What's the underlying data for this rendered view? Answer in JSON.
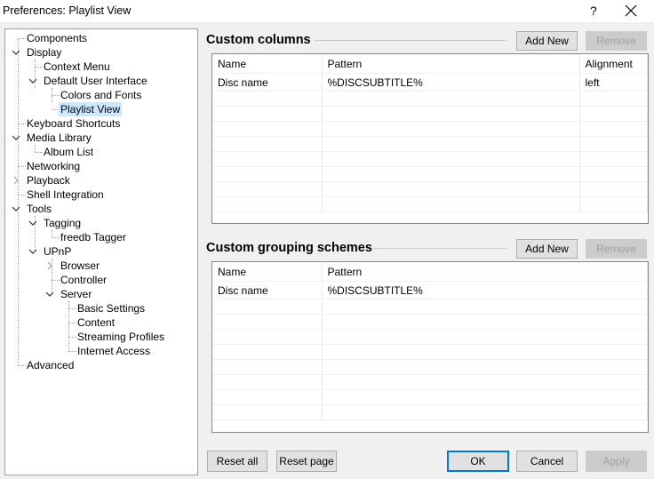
{
  "window": {
    "title": "Preferences: Playlist View",
    "help_label": "?"
  },
  "tree": {
    "components": "Components",
    "display": "Display",
    "context_menu": "Context Menu",
    "default_ui": "Default User Interface",
    "colors_fonts": "Colors and Fonts",
    "playlist_view": "Playlist View",
    "keyboard_shortcuts": "Keyboard Shortcuts",
    "media_library": "Media Library",
    "album_list": "Album List",
    "networking": "Networking",
    "playback": "Playback",
    "shell_integration": "Shell Integration",
    "tools": "Tools",
    "tagging": "Tagging",
    "freedb_tagger": "freedb Tagger",
    "upnp": "UPnP",
    "browser": "Browser",
    "controller": "Controller",
    "server": "Server",
    "basic_settings": "Basic Settings",
    "content": "Content",
    "streaming_profiles": "Streaming Profiles",
    "internet_access": "Internet Access",
    "advanced": "Advanced"
  },
  "custom_columns": {
    "title": "Custom columns",
    "add_new": "Add New",
    "remove": "Remove",
    "headers": [
      "Name",
      "Pattern",
      "Alignment"
    ],
    "rows": [
      [
        "Disc name",
        "%DISCSUBTITLE%",
        "left"
      ]
    ]
  },
  "custom_grouping": {
    "title": "Custom grouping schemes",
    "add_new": "Add New",
    "remove": "Remove",
    "headers": [
      "Name",
      "Pattern"
    ],
    "rows": [
      [
        "Disc name",
        "%DISCSUBTITLE%"
      ]
    ]
  },
  "footer": {
    "reset_all": "Reset all",
    "reset_page": "Reset page",
    "ok": "OK",
    "cancel": "Cancel",
    "apply": "Apply"
  }
}
